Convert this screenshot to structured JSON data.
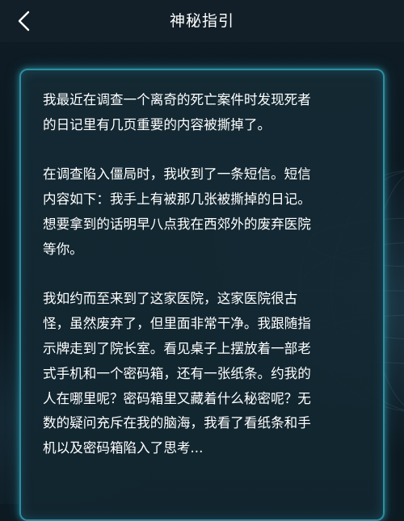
{
  "header": {
    "title": "神秘指引",
    "back_icon": "chevron-left-icon"
  },
  "story": {
    "paragraphs": [
      "我最近在调查一个离奇的死亡案件时发现死者\n的日记里有几页重要的内容被撕掉了。",
      "在调查陷入僵局时，我收到了一条短信。短信\n内容如下：我手上有被那几张被撕掉的日记。\n想要拿到的话明早八点我在西郊外的废弃医院\n等你。",
      "我如约而至来到了这家医院，这家医院很古\n怪，虽然废弃了，但里面非常干净。我跟随指\n示牌走到了院长室。看见桌子上摆放着一部老\n式手机和一个密码箱，还有一张纸条。约我的\n人在哪里呢？密码箱里又藏着什么秘密呢？无\n数的疑问充斥在我的脑海，我看了看纸条和手\n机以及密码箱陷入了思考..."
    ]
  },
  "colors": {
    "background": "#0d1a22",
    "header_bg": "#121f28",
    "panel_border": "#2c8ea2",
    "text": "#ffffff"
  }
}
